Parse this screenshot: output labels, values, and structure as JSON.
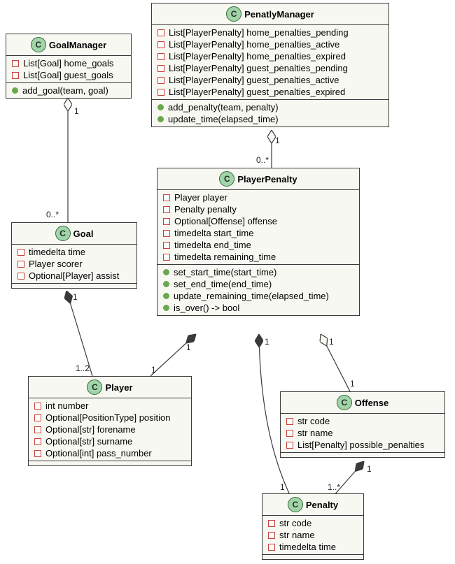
{
  "classes": {
    "goalManager": {
      "name": "GoalManager",
      "attrs": [
        "List[Goal] home_goals",
        "List[Goal] guest_goals"
      ],
      "methods": [
        "add_goal(team, goal)"
      ]
    },
    "penaltyManager": {
      "name": "PenatlyManager",
      "attrs": [
        "List[PlayerPenalty] home_penalties_pending",
        "List[PlayerPenalty] home_penalties_active",
        "List[PlayerPenalty] home_penalties_expired",
        "List[PlayerPenalty] guest_penalties_pending",
        "List[PlayerPenalty] guest_penalties_active",
        "List[PlayerPenalty] guest_penalties_expired"
      ],
      "methods": [
        "add_penalty(team, penalty)",
        "update_time(elapsed_time)"
      ]
    },
    "goal": {
      "name": "Goal",
      "attrs": [
        "timedelta time",
        "Player scorer",
        "Optional[Player] assist"
      ],
      "methods": []
    },
    "playerPenalty": {
      "name": "PlayerPenalty",
      "attrs": [
        "Player player",
        "Penalty penalty",
        "Optional[Offense] offense",
        "timedelta start_time",
        "timedelta end_time",
        "timedelta remaining_time"
      ],
      "methods": [
        "set_start_time(start_time)",
        "set_end_time(end_time)",
        "update_remaining_time(elapsed_time)",
        "is_over() -> bool"
      ]
    },
    "player": {
      "name": "Player",
      "attrs": [
        "int number",
        "Optional[PositionType] position",
        "Optional[str] forename",
        "Optional[str] surname",
        "Optional[int] pass_number"
      ],
      "methods": []
    },
    "offense": {
      "name": "Offense",
      "attrs": [
        "str code",
        "str name",
        "List[Penalty] possible_penalties"
      ],
      "methods": []
    },
    "penalty": {
      "name": "Penalty",
      "attrs": [
        "str code",
        "str name",
        "timedelta time"
      ],
      "methods": []
    }
  },
  "labels": {
    "gm_1": "1",
    "gm_many": "0..*",
    "pm_1": "1",
    "pm_many": "0..*",
    "goal_player_1": "1",
    "goal_player_12": "1..2",
    "pp_player_a": "1",
    "pp_player_b": "1",
    "pp_penalty_a": "1",
    "pp_penalty_b": "1",
    "pp_offense_a": "1",
    "pp_offense_b": "1",
    "off_pen_a": "1",
    "off_pen_b": "1..*"
  },
  "chart_data": {
    "type": "table",
    "diagram_type": "uml-class",
    "classes": [
      {
        "name": "GoalManager",
        "attributes": [
          {
            "visibility": "private",
            "type": "List[Goal]",
            "name": "home_goals"
          },
          {
            "visibility": "private",
            "type": "List[Goal]",
            "name": "guest_goals"
          }
        ],
        "methods": [
          {
            "visibility": "public",
            "name": "add_goal",
            "params": [
              "team",
              "goal"
            ]
          }
        ]
      },
      {
        "name": "PenatlyManager",
        "attributes": [
          {
            "visibility": "private",
            "type": "List[PlayerPenalty]",
            "name": "home_penalties_pending"
          },
          {
            "visibility": "private",
            "type": "List[PlayerPenalty]",
            "name": "home_penalties_active"
          },
          {
            "visibility": "private",
            "type": "List[PlayerPenalty]",
            "name": "home_penalties_expired"
          },
          {
            "visibility": "private",
            "type": "List[PlayerPenalty]",
            "name": "guest_penalties_pending"
          },
          {
            "visibility": "private",
            "type": "List[PlayerPenalty]",
            "name": "guest_penalties_active"
          },
          {
            "visibility": "private",
            "type": "List[PlayerPenalty]",
            "name": "guest_penalties_expired"
          }
        ],
        "methods": [
          {
            "visibility": "public",
            "name": "add_penalty",
            "params": [
              "team",
              "penalty"
            ]
          },
          {
            "visibility": "public",
            "name": "update_time",
            "params": [
              "elapsed_time"
            ]
          }
        ]
      },
      {
        "name": "Goal",
        "attributes": [
          {
            "visibility": "private",
            "type": "timedelta",
            "name": "time"
          },
          {
            "visibility": "private",
            "type": "Player",
            "name": "scorer"
          },
          {
            "visibility": "private",
            "type": "Optional[Player]",
            "name": "assist"
          }
        ],
        "methods": []
      },
      {
        "name": "PlayerPenalty",
        "attributes": [
          {
            "visibility": "private",
            "type": "Player",
            "name": "player"
          },
          {
            "visibility": "private",
            "type": "Penalty",
            "name": "penalty"
          },
          {
            "visibility": "private",
            "type": "Optional[Offense]",
            "name": "offense"
          },
          {
            "visibility": "private",
            "type": "timedelta",
            "name": "start_time"
          },
          {
            "visibility": "private",
            "type": "timedelta",
            "name": "end_time"
          },
          {
            "visibility": "private",
            "type": "timedelta",
            "name": "remaining_time"
          }
        ],
        "methods": [
          {
            "visibility": "public",
            "name": "set_start_time",
            "params": [
              "start_time"
            ]
          },
          {
            "visibility": "public",
            "name": "set_end_time",
            "params": [
              "end_time"
            ]
          },
          {
            "visibility": "public",
            "name": "update_remaining_time",
            "params": [
              "elapsed_time"
            ]
          },
          {
            "visibility": "public",
            "name": "is_over",
            "params": [],
            "returns": "bool"
          }
        ]
      },
      {
        "name": "Player",
        "attributes": [
          {
            "visibility": "private",
            "type": "int",
            "name": "number"
          },
          {
            "visibility": "private",
            "type": "Optional[PositionType]",
            "name": "position"
          },
          {
            "visibility": "private",
            "type": "Optional[str]",
            "name": "forename"
          },
          {
            "visibility": "private",
            "type": "Optional[str]",
            "name": "surname"
          },
          {
            "visibility": "private",
            "type": "Optional[int]",
            "name": "pass_number"
          }
        ],
        "methods": []
      },
      {
        "name": "Offense",
        "attributes": [
          {
            "visibility": "private",
            "type": "str",
            "name": "code"
          },
          {
            "visibility": "private",
            "type": "str",
            "name": "name"
          },
          {
            "visibility": "private",
            "type": "List[Penalty]",
            "name": "possible_penalties"
          }
        ],
        "methods": []
      },
      {
        "name": "Penalty",
        "attributes": [
          {
            "visibility": "private",
            "type": "str",
            "name": "code"
          },
          {
            "visibility": "private",
            "type": "str",
            "name": "name"
          },
          {
            "visibility": "private",
            "type": "timedelta",
            "name": "time"
          }
        ],
        "methods": []
      }
    ],
    "relationships": [
      {
        "from": "GoalManager",
        "to": "Goal",
        "type": "aggregation",
        "from_mult": "1",
        "to_mult": "0..*"
      },
      {
        "from": "PenatlyManager",
        "to": "PlayerPenalty",
        "type": "aggregation",
        "from_mult": "1",
        "to_mult": "0..*"
      },
      {
        "from": "Goal",
        "to": "Player",
        "type": "composition",
        "from_mult": "1",
        "to_mult": "1..2"
      },
      {
        "from": "PlayerPenalty",
        "to": "Player",
        "type": "composition",
        "from_mult": "1",
        "to_mult": "1"
      },
      {
        "from": "PlayerPenalty",
        "to": "Penalty",
        "type": "composition",
        "from_mult": "1",
        "to_mult": "1"
      },
      {
        "from": "PlayerPenalty",
        "to": "Offense",
        "type": "aggregation",
        "from_mult": "1",
        "to_mult": "1"
      },
      {
        "from": "Offense",
        "to": "Penalty",
        "type": "composition",
        "from_mult": "1",
        "to_mult": "1..*"
      }
    ]
  }
}
